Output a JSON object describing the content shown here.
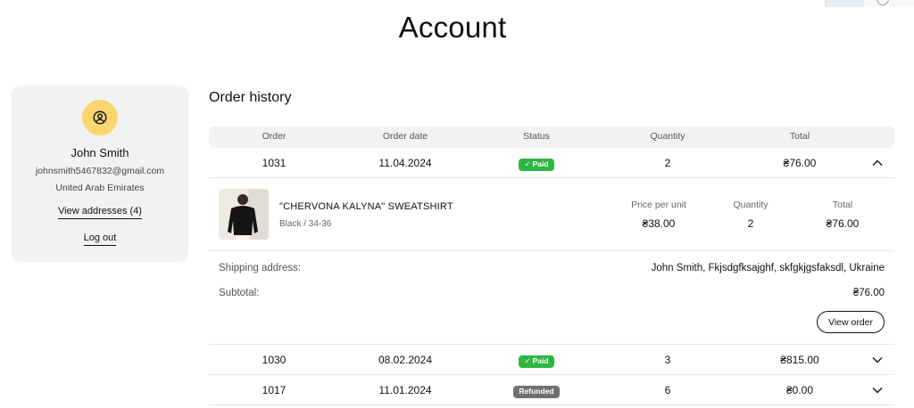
{
  "page": {
    "title": "Account"
  },
  "account": {
    "name": "John Smith",
    "email": "johnsmith5467832@gmail.com",
    "country": "United Arab Emirates",
    "addresses_link": "View addresses (4)",
    "logout_link": "Log out",
    "avatar_icon": "user-circle-icon",
    "avatar_color": "#fbd66e"
  },
  "orders": {
    "title": "Order history",
    "headers": {
      "order": "Order",
      "date": "Order date",
      "status": "Status",
      "quantity": "Quantity",
      "total": "Total"
    },
    "rows": [
      {
        "order": "1031",
        "date": "11.04.2024",
        "status": "Paid",
        "quantity": "2",
        "total": "₴76.00",
        "expanded": true
      },
      {
        "order": "1030",
        "date": "08.02.2024",
        "status": "Paid",
        "quantity": "3",
        "total": "₴815.00",
        "expanded": false
      },
      {
        "order": "1017",
        "date": "11.01.2024",
        "status": "Refunded",
        "quantity": "6",
        "total": "₴0.00",
        "expanded": false
      }
    ],
    "detail": {
      "item": {
        "name": "\"CHERVONA KALYNA\" SWEATSHIRT",
        "variant": "Black / 34-36",
        "price_label": "Price per unit",
        "price": "₴38.00",
        "qty_label": "Quantity",
        "qty": "2",
        "total_label": "Total",
        "total": "₴76.00"
      },
      "shipping_label": "Shipping address:",
      "shipping_value": "John Smith, Fkjsdgfksajghf, skfgkjgsfaksdl, Ukraine",
      "subtotal_label": "Subtotal:",
      "subtotal_value": "₴76.00",
      "view_order_label": "View order"
    }
  },
  "colors": {
    "paid": "#2db742",
    "refunded": "#707070",
    "card_bg": "#f2f2f2"
  }
}
